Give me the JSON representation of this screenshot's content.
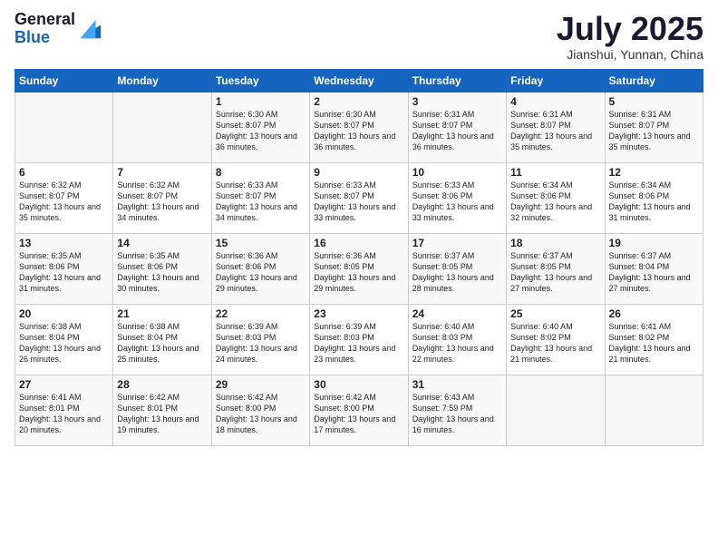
{
  "header": {
    "logo_line1": "General",
    "logo_line2": "Blue",
    "month": "July 2025",
    "location": "Jianshui, Yunnan, China"
  },
  "weekdays": [
    "Sunday",
    "Monday",
    "Tuesday",
    "Wednesday",
    "Thursday",
    "Friday",
    "Saturday"
  ],
  "weeks": [
    [
      {
        "day": "",
        "info": ""
      },
      {
        "day": "",
        "info": ""
      },
      {
        "day": "1",
        "info": "Sunrise: 6:30 AM\nSunset: 8:07 PM\nDaylight: 13 hours\nand 36 minutes."
      },
      {
        "day": "2",
        "info": "Sunrise: 6:30 AM\nSunset: 8:07 PM\nDaylight: 13 hours\nand 36 minutes."
      },
      {
        "day": "3",
        "info": "Sunrise: 6:31 AM\nSunset: 8:07 PM\nDaylight: 13 hours\nand 36 minutes."
      },
      {
        "day": "4",
        "info": "Sunrise: 6:31 AM\nSunset: 8:07 PM\nDaylight: 13 hours\nand 35 minutes."
      },
      {
        "day": "5",
        "info": "Sunrise: 6:31 AM\nSunset: 8:07 PM\nDaylight: 13 hours\nand 35 minutes."
      }
    ],
    [
      {
        "day": "6",
        "info": "Sunrise: 6:32 AM\nSunset: 8:07 PM\nDaylight: 13 hours\nand 35 minutes."
      },
      {
        "day": "7",
        "info": "Sunrise: 6:32 AM\nSunset: 8:07 PM\nDaylight: 13 hours\nand 34 minutes."
      },
      {
        "day": "8",
        "info": "Sunrise: 6:33 AM\nSunset: 8:07 PM\nDaylight: 13 hours\nand 34 minutes."
      },
      {
        "day": "9",
        "info": "Sunrise: 6:33 AM\nSunset: 8:07 PM\nDaylight: 13 hours\nand 33 minutes."
      },
      {
        "day": "10",
        "info": "Sunrise: 6:33 AM\nSunset: 8:06 PM\nDaylight: 13 hours\nand 33 minutes."
      },
      {
        "day": "11",
        "info": "Sunrise: 6:34 AM\nSunset: 8:06 PM\nDaylight: 13 hours\nand 32 minutes."
      },
      {
        "day": "12",
        "info": "Sunrise: 6:34 AM\nSunset: 8:06 PM\nDaylight: 13 hours\nand 31 minutes."
      }
    ],
    [
      {
        "day": "13",
        "info": "Sunrise: 6:35 AM\nSunset: 8:06 PM\nDaylight: 13 hours\nand 31 minutes."
      },
      {
        "day": "14",
        "info": "Sunrise: 6:35 AM\nSunset: 8:06 PM\nDaylight: 13 hours\nand 30 minutes."
      },
      {
        "day": "15",
        "info": "Sunrise: 6:36 AM\nSunset: 8:06 PM\nDaylight: 13 hours\nand 29 minutes."
      },
      {
        "day": "16",
        "info": "Sunrise: 6:36 AM\nSunset: 8:05 PM\nDaylight: 13 hours\nand 29 minutes."
      },
      {
        "day": "17",
        "info": "Sunrise: 6:37 AM\nSunset: 8:05 PM\nDaylight: 13 hours\nand 28 minutes."
      },
      {
        "day": "18",
        "info": "Sunrise: 6:37 AM\nSunset: 8:05 PM\nDaylight: 13 hours\nand 27 minutes."
      },
      {
        "day": "19",
        "info": "Sunrise: 6:37 AM\nSunset: 8:04 PM\nDaylight: 13 hours\nand 27 minutes."
      }
    ],
    [
      {
        "day": "20",
        "info": "Sunrise: 6:38 AM\nSunset: 8:04 PM\nDaylight: 13 hours\nand 26 minutes."
      },
      {
        "day": "21",
        "info": "Sunrise: 6:38 AM\nSunset: 8:04 PM\nDaylight: 13 hours\nand 25 minutes."
      },
      {
        "day": "22",
        "info": "Sunrise: 6:39 AM\nSunset: 8:03 PM\nDaylight: 13 hours\nand 24 minutes."
      },
      {
        "day": "23",
        "info": "Sunrise: 6:39 AM\nSunset: 8:03 PM\nDaylight: 13 hours\nand 23 minutes."
      },
      {
        "day": "24",
        "info": "Sunrise: 6:40 AM\nSunset: 8:03 PM\nDaylight: 13 hours\nand 22 minutes."
      },
      {
        "day": "25",
        "info": "Sunrise: 6:40 AM\nSunset: 8:02 PM\nDaylight: 13 hours\nand 21 minutes."
      },
      {
        "day": "26",
        "info": "Sunrise: 6:41 AM\nSunset: 8:02 PM\nDaylight: 13 hours\nand 21 minutes."
      }
    ],
    [
      {
        "day": "27",
        "info": "Sunrise: 6:41 AM\nSunset: 8:01 PM\nDaylight: 13 hours\nand 20 minutes."
      },
      {
        "day": "28",
        "info": "Sunrise: 6:42 AM\nSunset: 8:01 PM\nDaylight: 13 hours\nand 19 minutes."
      },
      {
        "day": "29",
        "info": "Sunrise: 6:42 AM\nSunset: 8:00 PM\nDaylight: 13 hours\nand 18 minutes."
      },
      {
        "day": "30",
        "info": "Sunrise: 6:42 AM\nSunset: 8:00 PM\nDaylight: 13 hours\nand 17 minutes."
      },
      {
        "day": "31",
        "info": "Sunrise: 6:43 AM\nSunset: 7:59 PM\nDaylight: 13 hours\nand 16 minutes."
      },
      {
        "day": "",
        "info": ""
      },
      {
        "day": "",
        "info": ""
      }
    ]
  ]
}
